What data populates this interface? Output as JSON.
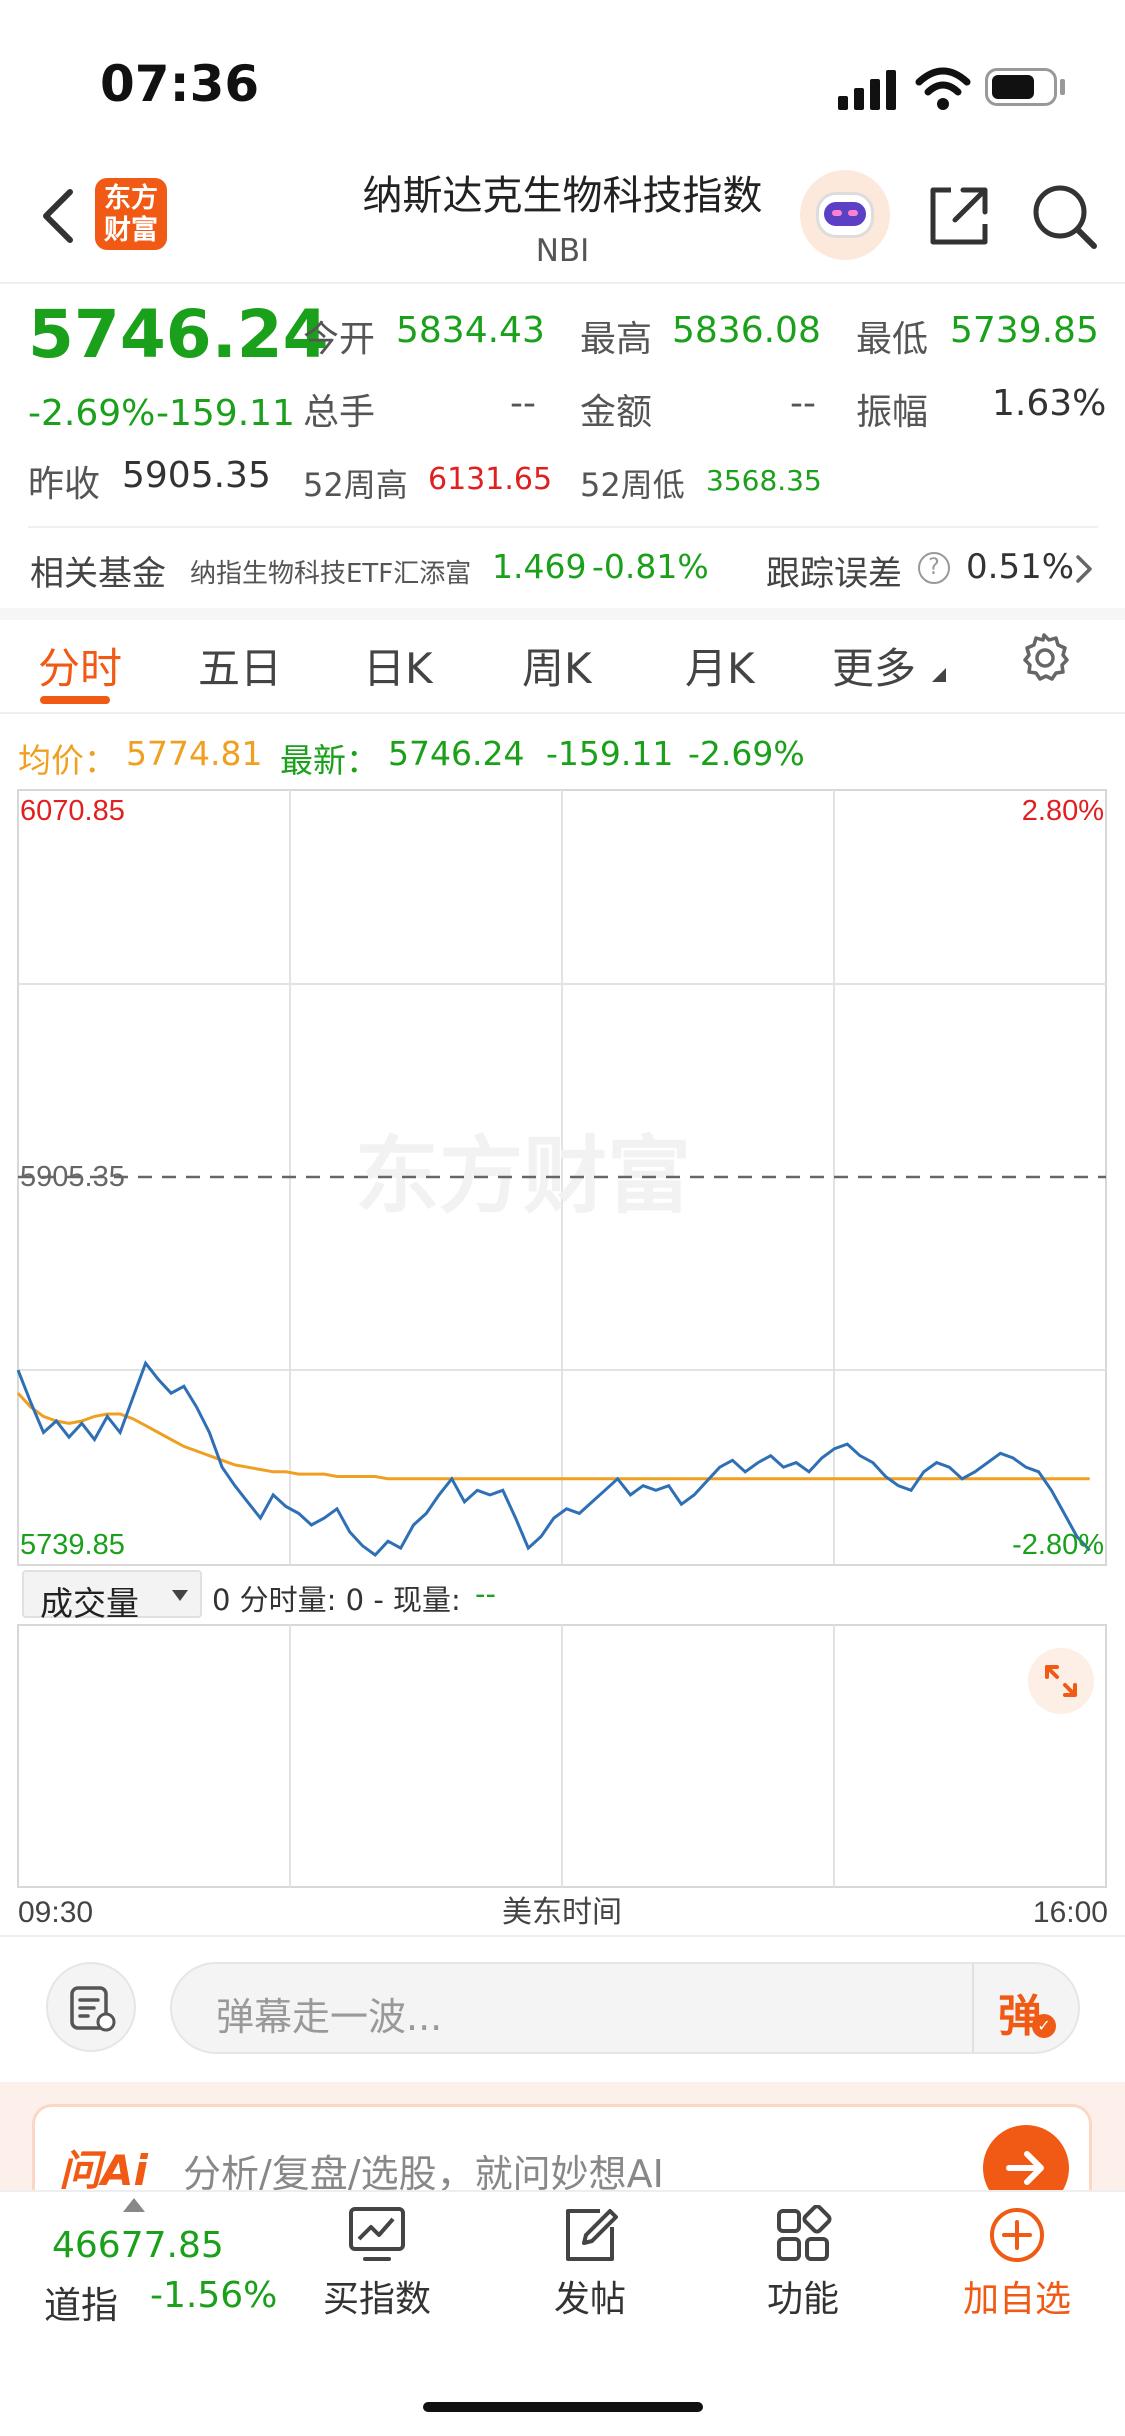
{
  "status": {
    "time": "07:36"
  },
  "header": {
    "logo_text_line1": "东方",
    "logo_text_line2": "财富",
    "title": "纳斯达克生物科技指数",
    "subtitle": "NBI"
  },
  "quote": {
    "price": "5746.24",
    "change_pct": "-2.69%",
    "change": "-159.11",
    "open_label": "今开",
    "open": "5834.43",
    "high_label": "最高",
    "high": "5836.08",
    "low_label": "最低",
    "low": "5739.85",
    "volume_label": "总手",
    "volume": "--",
    "amount_label": "金额",
    "amount": "--",
    "amplitude_label": "振幅",
    "amplitude": "1.63%",
    "prev_close_label": "昨收",
    "prev_close": "5905.35",
    "wk52_high_label": "52周高",
    "wk52_high": "6131.65",
    "wk52_low_label": "52周低",
    "wk52_low": "3568.35"
  },
  "fund": {
    "label": "相关基金",
    "name": "纳指生物科技ETF汇添富",
    "price": "1.469",
    "change": "-0.81%",
    "tracking_label": "跟踪误差",
    "tracking_value": "0.51%"
  },
  "tabs": [
    "分时",
    "五日",
    "日K",
    "周K",
    "月K",
    "更多"
  ],
  "chart_info": {
    "avg_label": "均价：",
    "avg_value": "5774.81",
    "latest_label": "最新：",
    "latest_value": "5746.24",
    "latest_change": "-159.11",
    "latest_pct": "-2.69%"
  },
  "chart_data": {
    "type": "line",
    "y_top_label": "6070.85",
    "y_mid_label": "5905.35",
    "y_bottom_label": "5739.85",
    "pct_top_label": "2.80%",
    "pct_bottom_label": "-2.80%",
    "ylim": [
      5739.85,
      6070.85
    ],
    "reference": 5905.35,
    "x_start_label": "09:30",
    "x_end_label": "16:00",
    "x_center_label": "美东时间",
    "series": [
      {
        "values": [
          5822,
          5808,
          5795,
          5800,
          5793,
          5799,
          5792,
          5802,
          5795,
          5810,
          5825,
          5818,
          5812,
          5815,
          5806,
          5795,
          5780,
          5772,
          5765,
          5758,
          5768,
          5763,
          5760,
          5755,
          5758,
          5762,
          5752,
          5746,
          5742,
          5748,
          5745,
          5755,
          5760,
          5768,
          5775,
          5765,
          5770,
          5768,
          5770,
          5758,
          5745,
          5750,
          5758,
          5762,
          5760,
          5765,
          5770,
          5775,
          5768,
          5772,
          5770,
          5772,
          5764,
          5768,
          5774,
          5780,
          5783,
          5778,
          5782,
          5785,
          5780,
          5782,
          5778,
          5784,
          5788,
          5790,
          5785,
          5782,
          5776,
          5772,
          5770,
          5778,
          5782,
          5780,
          5775,
          5778,
          5782,
          5786,
          5784,
          5780,
          5778,
          5770,
          5760,
          5750,
          5744
        ]
      },
      {
        "values": [
          5812,
          5806,
          5802,
          5800,
          5799,
          5800,
          5802,
          5803,
          5803,
          5801,
          5798,
          5795,
          5792,
          5789,
          5787,
          5785,
          5783,
          5781,
          5780,
          5779,
          5778,
          5778,
          5777,
          5777,
          5777,
          5776,
          5776,
          5776,
          5776,
          5775,
          5775,
          5775,
          5775,
          5775,
          5775,
          5775,
          5775,
          5775,
          5775,
          5775,
          5775,
          5775,
          5775,
          5775,
          5775,
          5775,
          5775,
          5775,
          5775,
          5775,
          5775,
          5775,
          5775,
          5775,
          5775,
          5775,
          5775,
          5775,
          5775,
          5775,
          5775,
          5775,
          5775,
          5775,
          5775,
          5775,
          5775,
          5775,
          5775,
          5775,
          5775,
          5775,
          5775,
          5775,
          5775,
          5775,
          5775,
          5775,
          5775,
          5775,
          5775,
          5775,
          5775,
          5775,
          5775
        ]
      }
    ],
    "colors": {
      "price": "#2f6fb5",
      "avg": "#f0a020"
    }
  },
  "volume_panel": {
    "selector": "成交量",
    "text_prefix": "0 分时量: 0 - 现量:",
    "text_suffix": "--"
  },
  "danmaku": {
    "placeholder": "弹幕走一波...",
    "button": "弹"
  },
  "ai_banner": {
    "brand": "问Ai",
    "text": "分析/复盘/选股，就问妙想AI"
  },
  "bottom_bar": {
    "index_value": "46677.85",
    "index_name": "道指",
    "index_change": "-1.56%",
    "items": [
      "买指数",
      "发帖",
      "功能",
      "加自选"
    ]
  },
  "colors": {
    "brand": "#f05a14",
    "down": "#1aa01a",
    "up": "#e02020"
  }
}
